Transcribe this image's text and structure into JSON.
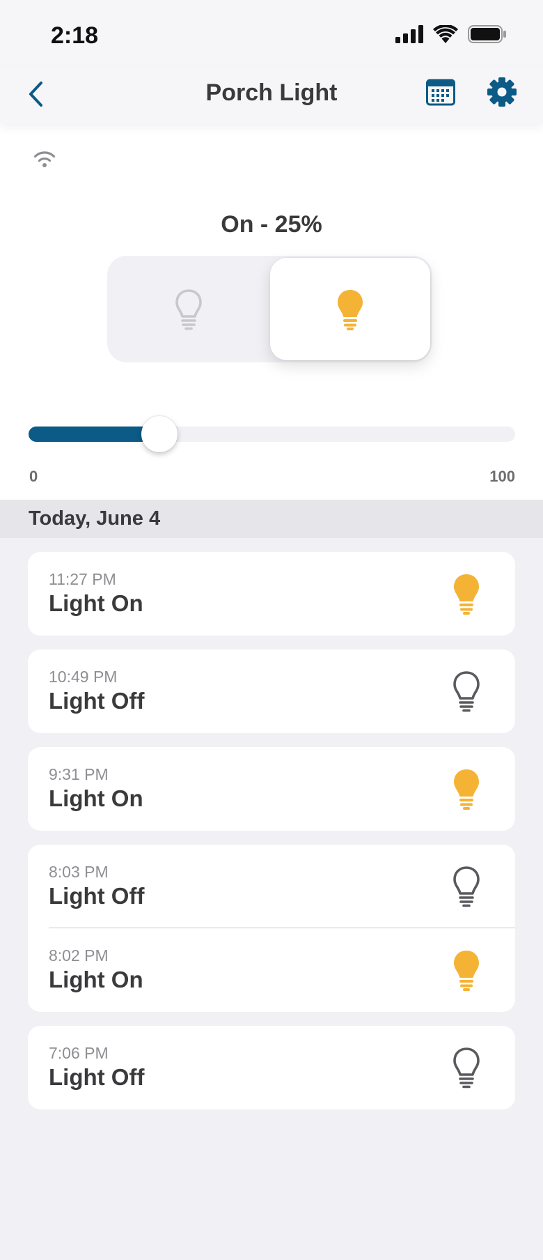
{
  "status_bar": {
    "time": "2:18"
  },
  "nav": {
    "title": "Porch Light"
  },
  "control": {
    "state_label": "On - 25%",
    "brightness_percent": 25,
    "slider_min": "0",
    "slider_max": "100",
    "selected": "on"
  },
  "colors": {
    "accent": "#0c5a86",
    "bulb_on": "#f5b335",
    "bulb_off_control": "#c7c7cc",
    "bulb_off_row": "#5a5a5e"
  },
  "history": {
    "section_title": "Today, June 4",
    "cards": [
      [
        {
          "time": "11:27 PM",
          "label": "Light On",
          "icon": "bulb-on-icon"
        }
      ],
      [
        {
          "time": "10:49 PM",
          "label": "Light Off",
          "icon": "bulb-off-icon"
        }
      ],
      [
        {
          "time": "9:31 PM",
          "label": "Light On",
          "icon": "bulb-on-icon"
        }
      ],
      [
        {
          "time": "8:03 PM",
          "label": "Light Off",
          "icon": "bulb-off-icon"
        },
        {
          "time": "8:02 PM",
          "label": "Light On",
          "icon": "bulb-on-icon"
        }
      ],
      [
        {
          "time": "7:06 PM",
          "label": "Light Off",
          "icon": "bulb-off-icon"
        }
      ]
    ]
  }
}
